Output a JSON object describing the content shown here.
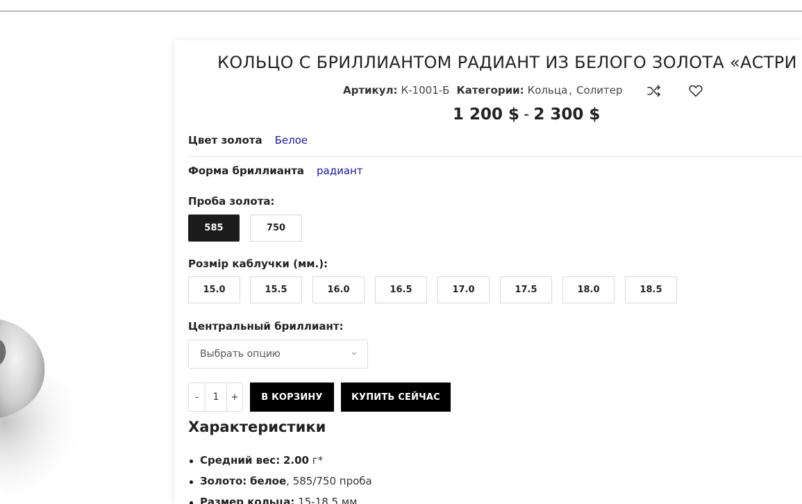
{
  "product": {
    "title": "КОЛЬЦО С БРИЛЛИАНТОМ РАДИАНТ ИЗ БЕЛОГО ЗОЛОТА «АСТРИ",
    "sku_label": "Артикул:",
    "sku_value": "К-1001-Б",
    "categories_label": "Категории:",
    "categories": [
      "Кольца",
      "Солитер"
    ],
    "category_separator": ",",
    "price_min": "1 200 $",
    "price_dash": "-",
    "price_max": "2 300 $"
  },
  "icons": {
    "compare": "shuffle-icon",
    "wishlist": "heart-icon"
  },
  "attributes": [
    {
      "label": "Цвет золота",
      "value": "Белое"
    },
    {
      "label": "Форма бриллианта",
      "value": "радиант"
    }
  ],
  "gold_proba": {
    "label": "Проба золота:",
    "options": [
      "585",
      "750"
    ],
    "selected": "585"
  },
  "ring_size": {
    "label": "Розмір каблучки (мм.):",
    "options": [
      "15.0",
      "15.5",
      "16.0",
      "16.5",
      "17.0",
      "17.5",
      "18.0",
      "18.5"
    ]
  },
  "central_diamond": {
    "label": "Центральный бриллиант:",
    "placeholder": "Выбрать опцию"
  },
  "cart": {
    "qty_minus": "-",
    "qty_value": "1",
    "qty_plus": "+",
    "add_to_cart": "В КОРЗИНУ",
    "buy_now": "КУПИТЬ СЕЙЧАС"
  },
  "characteristics": {
    "title": "Характеристики",
    "items": [
      {
        "key": "Средний вес:",
        "bold_value": "2.00",
        "rest": " г*"
      },
      {
        "key": "Золото:",
        "bold_value": "белое",
        "rest": ", 585/750 проба"
      },
      {
        "key": "Размер кольца:",
        "bold_value": "",
        "rest": " 15-18.5 мм"
      }
    ]
  },
  "colors": {
    "selected_swatch_bg": "#1c1c1c",
    "attr_link": "#1a1a8c",
    "button_bg": "#000000"
  }
}
